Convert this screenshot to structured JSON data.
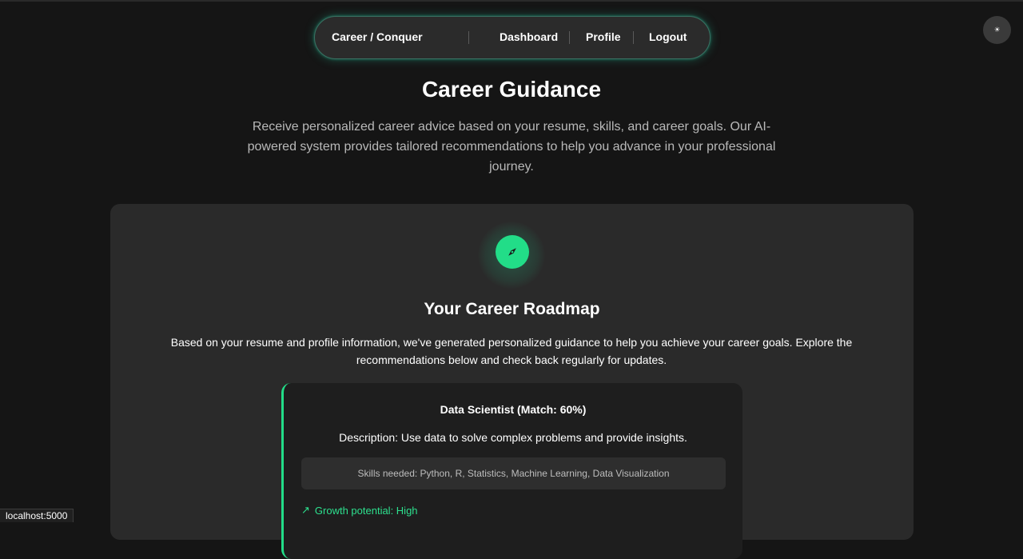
{
  "navbar": {
    "brand": "Career / Conquer",
    "links": [
      "Dashboard",
      "Profile",
      "Logout"
    ]
  },
  "theme_toggle": {
    "glyph": "☀",
    "icon": "sun-icon"
  },
  "hero": {
    "title": "Career Guidance",
    "description": "Receive personalized career advice based on your resume, skills, and career goals. Our AI-powered system provides tailored recommendations to help you advance in your professional journey."
  },
  "roadmap": {
    "icon": "compass-icon",
    "title": "Your Career Roadmap",
    "description": "Based on your resume and profile information, we've generated personalized guidance to help you achieve your career goals. Explore the recommendations below and check back regularly for updates."
  },
  "recommendation": {
    "title": "Data Scientist (Match: 60%)",
    "description": "Description: Use data to solve complex problems and provide insights.",
    "skills": "Skills needed: Python, R, Statistics, Machine Learning, Data Visualization",
    "growth_icon": "↗",
    "growth": "Growth potential: High"
  },
  "status_bar": {
    "url": "localhost:5000"
  },
  "colors": {
    "accent": "#22dd88",
    "background": "#151515",
    "card": "#2a2a2a"
  }
}
